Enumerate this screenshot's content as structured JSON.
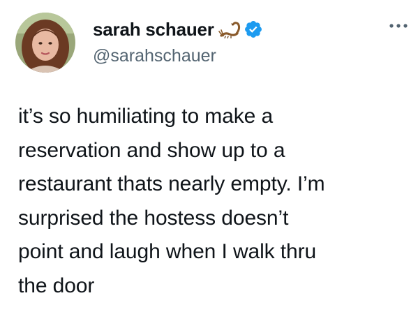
{
  "author": {
    "display_name": "sarah schauer",
    "handle": "@sarahschauer",
    "emoji_icon": "scorpion-icon",
    "verified_icon": "verified-badge-icon",
    "avatar_icon": "profile-photo"
  },
  "tweet": {
    "text": "it’s so humiliating to make a\nreservation and show up to a\nrestaurant thats nearly empty. I’m\nsurprised the hostess doesn’t\npoint and laugh when I walk thru\nthe door"
  },
  "menu": {
    "icon": "more-options-icon"
  },
  "colors": {
    "text": "#0f1419",
    "secondary_text": "#536471",
    "verified_blue": "#1d9bf0",
    "background": "#ffffff"
  }
}
